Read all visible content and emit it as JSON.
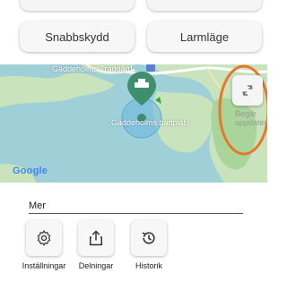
{
  "top_buttons": {
    "left": "Snabbskydd",
    "right": "Larmläge"
  },
  "map": {
    "place_garden": "Gäddeholms Trädgård",
    "place_beach": "Gäddeholms badplats",
    "refresh_label": "Begär uppdatering",
    "provider": "Google"
  },
  "more": {
    "title": "Mer",
    "actions": [
      {
        "label": "Inställningar",
        "icon": "gear-icon"
      },
      {
        "label": "Delningar",
        "icon": "share-icon"
      },
      {
        "label": "Historik",
        "icon": "history-icon"
      }
    ]
  },
  "colors": {
    "water": "#9fd0d8",
    "land": "#c9e3bd",
    "pin": "#3f8f6f",
    "highlight_ring": "#e8772e"
  }
}
